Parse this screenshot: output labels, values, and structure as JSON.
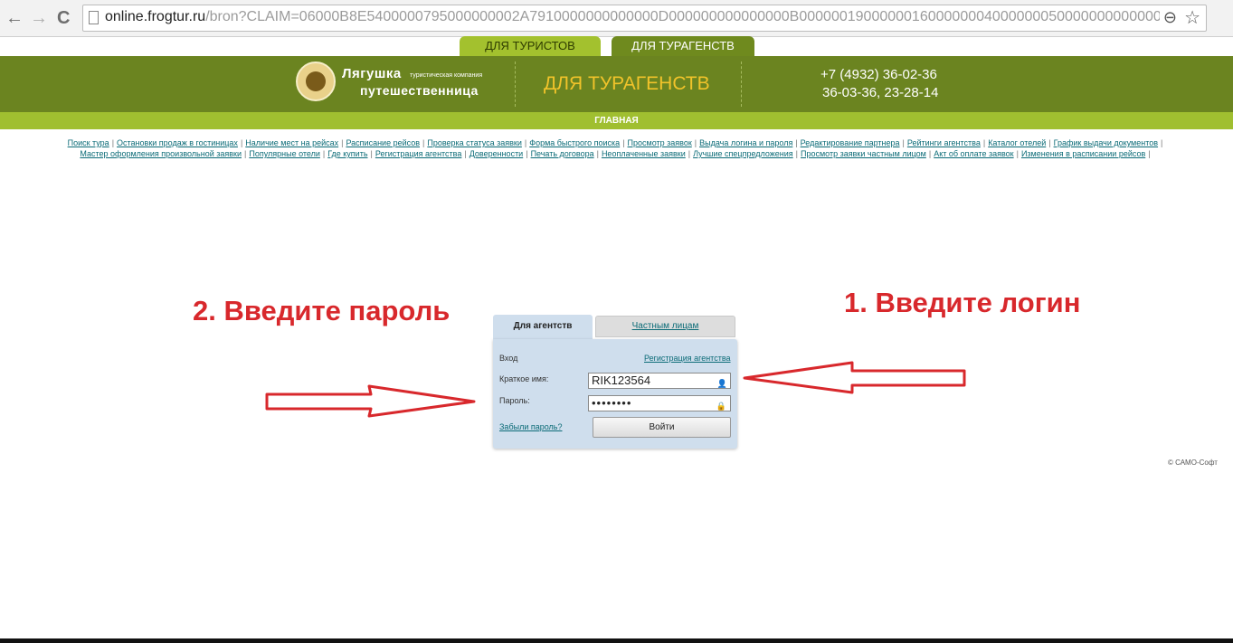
{
  "browser": {
    "back": "←",
    "forward": "→",
    "reload": "C",
    "url_host": "online.frogtur.ru",
    "url_rest": "/bron?CLAIM=06000B8E5400000795000000002A7910000000000000D000000000000000B0000001900000016000000040000000500000000000000000000(",
    "zoom_glyph": "⊖",
    "star_glyph": "☆"
  },
  "site_tabs": {
    "tourists": "ДЛЯ ТУРИСТОВ",
    "agencies": "ДЛЯ ТУРАГЕНСТВ"
  },
  "header": {
    "logo_line1": "Лягушка",
    "logo_subtitle": "туристическая компания",
    "logo_line2": "путешественница",
    "title": "ДЛЯ ТУРАГЕНСТВ",
    "phone1": "+7 (4932) 36-02-36",
    "phone2": "36-03-36, 23-28-14"
  },
  "main_bar": "ГЛАВНАЯ",
  "links": [
    "Поиск тура",
    "Остановки продаж в гостиницах",
    "Наличие мест на рейсах",
    "Расписание рейсов",
    "Проверка статуса заявки",
    "Форма быстрого поиска",
    "Просмотр заявок",
    "Выдача логина и пароля",
    "Редактирование партнера",
    "Рейтинги агентства",
    "Каталог отелей",
    "График выдачи документов",
    "Мастер оформления произвольной заявки",
    "Популярные отели",
    "Где купить",
    "Регистрация агентства",
    "Доверенности",
    "Печать договора",
    "Неоплаченные заявки",
    "Лучшие спецпредложения",
    "Просмотр заявки частным лицом",
    "Акт об оплате заявок",
    "Изменения в расписании рейсов"
  ],
  "annotations": {
    "left": "2. Введите пароль",
    "right": "1. Введите логин"
  },
  "login": {
    "tab_agencies": "Для агентств",
    "tab_private": "Частным лицам",
    "entry_label": "Вход",
    "register_link": "Регистрация агентства",
    "username_label": "Краткое имя:",
    "username_value": "RIK123564",
    "password_label": "Пароль:",
    "password_value": "••••••••",
    "forgot_link": "Забыли пароль?",
    "submit": "Войти",
    "user_glyph": "👤",
    "lock_glyph": "🔒"
  },
  "copyright": "© САМО-Софт",
  "colors": {
    "header_green": "#6b8420",
    "light_green": "#a0bf30",
    "annotation_red": "#d8282c",
    "link": "#0b6b77"
  }
}
